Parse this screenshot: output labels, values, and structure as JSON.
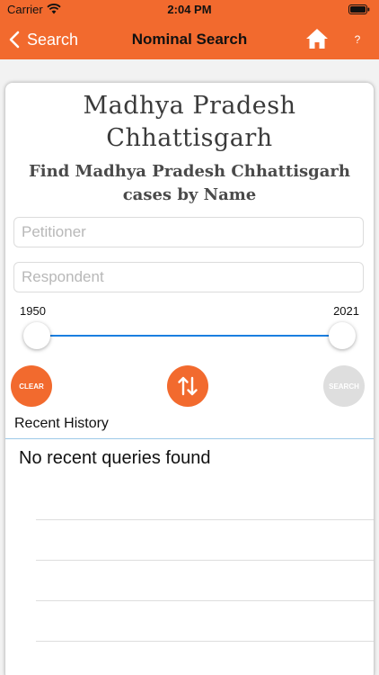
{
  "status_bar": {
    "carrier": "Carrier",
    "time": "2:04 PM"
  },
  "nav": {
    "back_label": "Search",
    "title": "Nominal Search",
    "help_label": "?"
  },
  "form": {
    "title": "Madhya Pradesh Chhattisgarh",
    "subtitle": "Find Madhya Pradesh Chhattisgarh cases by Name",
    "petitioner_placeholder": "Petitioner",
    "respondent_placeholder": "Respondent",
    "year_min": "1950",
    "year_max": "2021",
    "range_from_fraction": 0.0,
    "range_to_fraction": 1.0,
    "clear_label": "CLEAR",
    "search_label": "SEARCH"
  },
  "recent": {
    "heading": "Recent History",
    "empty_message": "No recent queries found"
  },
  "icons": {
    "back": "chevron-left-icon",
    "home": "home-icon",
    "swap": "swap-vertical-icon",
    "wifi": "wifi-icon",
    "battery": "battery-icon"
  },
  "colors": {
    "accent": "#f26a2e",
    "slider_track": "#1b7fe0",
    "disabled_button": "#dedede"
  }
}
